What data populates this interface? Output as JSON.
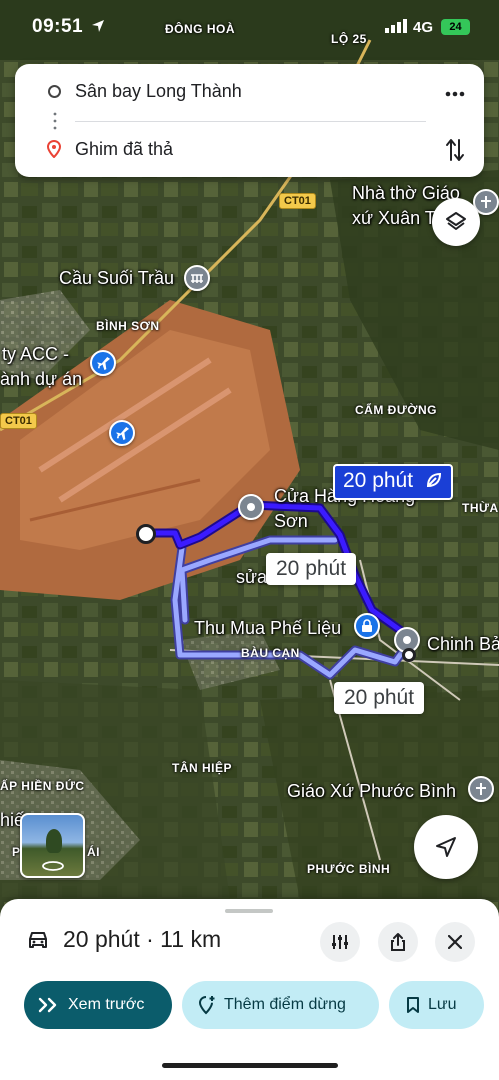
{
  "status_bar": {
    "time": "09:51",
    "network": "4G",
    "battery": "24"
  },
  "directions": {
    "origin": "Sân bay Long Thành",
    "destination": "Ghim đã thả"
  },
  "map": {
    "places": {
      "dong_hoa": "ĐÔNG HOÀ",
      "lo25": "LỘ 25",
      "ct01_a": "CT01",
      "ct01_b": "CT01",
      "nha_tho_1": "Nhà thờ Giáo",
      "nha_tho_2": "xứ Xuân T",
      "cau_suoi_trau": "Cầu Suối Trầu",
      "binh_son": "BÌNH SƠN",
      "acc_1": "ty ACC -",
      "acc_2": "ành dự án",
      "cam_duong": "CẨM ĐƯỜNG",
      "thua": "THỪA",
      "cua_hang_1": "Cửa Hàng Hoàng",
      "cua_hang_2": "Sơn",
      "sua": "sửa",
      "thu_mua": "Thu Mua Phế Liệu",
      "chinh_ba": "Chinh Bả",
      "bau_can": "BÀU CẠN",
      "tan_hiep": "TÂN HIỆP",
      "hien_duc": "ẤP HIỀN ĐỨC",
      "thie": "hiế",
      "giao_xu_phuoc_binh": "Giáo Xứ Phước Bình",
      "phuoc_binh": "PHƯỚC BÌNH",
      "ai": "ÁI",
      "p": "P"
    },
    "route_labels": {
      "primary": "20 phút",
      "alt1": "20 phút",
      "alt2": "20 phút"
    },
    "colors": {
      "route_primary": "#3b1bff",
      "route_alt": "#9aa8ff",
      "callout_primary": "#1a3fd6"
    }
  },
  "sheet": {
    "mode_icon": "car-icon",
    "summary": "20 phút · 11 km",
    "preview_label": "Xem trước",
    "add_stop_label": "Thêm điểm dừng",
    "save_label": "Lưu"
  }
}
